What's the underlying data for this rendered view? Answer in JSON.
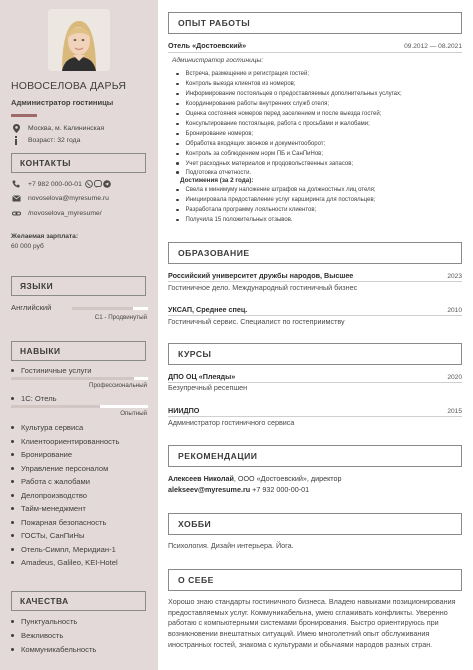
{
  "profile": {
    "name": "НОВОСЕЛОВА ДАРЬЯ",
    "title": "Администратор гостиницы",
    "location": "Москва, м. Калининская",
    "age": "Возраст: 32 года"
  },
  "contacts": {
    "heading": "КОНТАКТЫ",
    "phone": "+7 982 000-00-01",
    "email": "novoselova@myresume.ru",
    "site": "/novoselova_myresume/"
  },
  "salary": {
    "label": "Желаемая зарплата:",
    "value": "60 000 руб"
  },
  "languages": {
    "heading": "ЯЗЫКИ",
    "items": [
      {
        "name": "Английский",
        "level": "С1 - Продвинутый",
        "fill": 0.8
      }
    ]
  },
  "skills": {
    "heading": "НАВЫКИ",
    "rated": [
      {
        "name": "Гостиничные услуги",
        "level": "Профессиональный",
        "fill": 0.9
      },
      {
        "name": "1С: Отель",
        "level": "Опытный",
        "fill": 0.65
      }
    ],
    "list": [
      "Культура сервиса",
      "Клиентоориентированность",
      "Бронирование",
      "Управление персоналом",
      "Работа с жалобами",
      "Делопроизводство",
      "Тайм-менеджмент",
      "Пожарная безопасность",
      "ГОСТы, СанПиНы",
      "Отель-Симпл, Меридиан-1",
      "Amadeus, Galileo, KEI-Hotel"
    ]
  },
  "qualities": {
    "heading": "КАЧЕСТВА",
    "items": [
      "Пунктуальность",
      "Вежливость",
      "Коммуникабельность"
    ]
  },
  "experience": {
    "heading": "ОПЫТ РАБОТЫ",
    "company": "Отель «Достоевский»",
    "dates": "09.2012 — 08.2021",
    "position": "Администратор гостиницы:",
    "duties": [
      "Встреча, размещение и регистрация гостей;",
      "Контроль выезда клиентов из номеров;",
      "Информирование постояльцев о предоставляемых дополнительных услугах;",
      "Координирование работы внутренних служб отеля;",
      "Оценка состояния номеров перед заселением и после выезда гостей;",
      "Консультирование постояльцев, работа с просьбами и жалобами;",
      "Бронирование номеров;",
      "Обработка входящих звонков и документооборот;",
      "Контроль за соблюдением норм ПБ и СанПиНов;",
      "Учет расходных материалов и продовольственных запасов;",
      "Подготовка отчетности."
    ],
    "achievements_heading": "Достижения (за 2 года):",
    "achievements": [
      "Свела к минимуму наложение штрафов на должностных лиц отеля;",
      "Инициировала предоставление услуг карширинга для постояльцев;",
      "Разработала программу лояльности клиентов;",
      "Получила 15 положительных отзывов."
    ]
  },
  "education": {
    "heading": "ОБРАЗОВАНИЕ",
    "items": [
      {
        "institution": "Российский университет дружбы народов, Высшее",
        "year": "2023",
        "field": "Гостиничное дело. Международный гостиничный бизнес"
      },
      {
        "institution": "УКСАП, Среднее спец.",
        "year": "2010",
        "field": "Гостиничный сервис. Специалист по гостеприимству"
      }
    ]
  },
  "courses": {
    "heading": "КУРСЫ",
    "items": [
      {
        "org": "ДПО ОЦ «Плеяды»",
        "year": "2020",
        "name": "Безупречный ресепшен"
      },
      {
        "org": "НИИДПО",
        "year": "2015",
        "name": "Администратор гостиничного сервиса"
      }
    ]
  },
  "recommendations": {
    "heading": "РЕКОМЕНДАЦИИ",
    "person": "Алексеев Николай",
    "details": ", ООО «Достоевский», директор",
    "email": "alekseev@myresume.ru",
    "phone": "+7 932 000-00-01"
  },
  "hobby": {
    "heading": "ХОББИ",
    "text": "Психология. Дизайн интерьера. Йога."
  },
  "about": {
    "heading": "О СЕБЕ",
    "text": "Хорошо знаю стандарты гостиничного бизнеса. Владею навыками позиционирования предоставляемых услуг. Коммуникабельна, умею сглаживать конфликты. Уверенно работаю с компьютерными системами бронирования. Быстро ориентируюсь при возникновении внештатных ситуаций. Имею многолетний опыт обслуживания иностранных гостей, знакома с культурами и обычаями народов разных стран."
  },
  "colors": {
    "sidebar": "#e3d9d8",
    "accent": "#a0696b",
    "bar": "#d2c6c5"
  }
}
